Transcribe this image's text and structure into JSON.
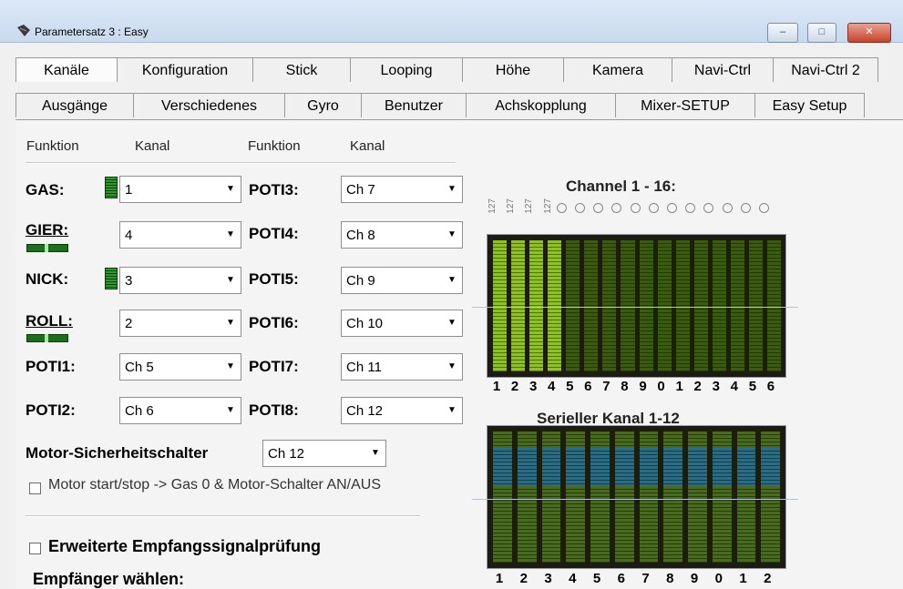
{
  "window": {
    "title": "Parametersatz 3 : Easy",
    "controls": [
      "–",
      "□",
      "✕"
    ]
  },
  "tabs_row1": [
    "Kanäle",
    "Konfiguration",
    "Stick",
    "Looping",
    "Höhe",
    "Kamera",
    "Navi-Ctrl",
    "Navi-Ctrl 2"
  ],
  "tabs_row2": [
    "Ausgänge",
    "Verschiedenes",
    "Gyro",
    "Benutzer",
    "Achskopplung",
    "Mixer-SETUP",
    "Easy Setup"
  ],
  "headers": {
    "funktion1": "Funktion",
    "kanal1": "Kanal",
    "funktion2": "Funktion",
    "kanal2": "Kanal"
  },
  "left_channels": [
    {
      "label": "GAS:",
      "value": "1"
    },
    {
      "label": "GIER:",
      "value": "4"
    },
    {
      "label": "NICK:",
      "value": "3"
    },
    {
      "label": "ROLL:",
      "value": "2"
    },
    {
      "label": "POTI1:",
      "value": "Ch 5"
    },
    {
      "label": "POTI2:",
      "value": "Ch 6"
    }
  ],
  "right_channels": [
    {
      "label": "POTI3:",
      "value": "Ch 7"
    },
    {
      "label": "POTI4:",
      "value": "Ch 8"
    },
    {
      "label": "POTI5:",
      "value": "Ch 9"
    },
    {
      "label": "POTI6:",
      "value": "Ch 10"
    },
    {
      "label": "POTI7:",
      "value": "Ch 11"
    },
    {
      "label": "POTI8:",
      "value": "Ch 12"
    }
  ],
  "motor_switch": {
    "label": "Motor-Sicherheitschalter",
    "value": "Ch 12"
  },
  "motor_start_stop": {
    "label": "Motor start/stop -> Gas 0 & Motor-Schalter AN/AUS",
    "checked": false
  },
  "extended_check": {
    "label": "Erweiterte Empfangssignalprüfung",
    "checked": false
  },
  "receiver_label": "Empfänger wählen:",
  "channel_display": {
    "title": "Channel 1 - 16:",
    "top_values": [
      "127",
      "127",
      "127",
      "127"
    ],
    "numbers": [
      "1",
      "2",
      "3",
      "4",
      "5",
      "6",
      "7",
      "8",
      "9",
      "0",
      "1",
      "2",
      "3",
      "4",
      "5",
      "6"
    ],
    "lit_channels": 4
  },
  "serial_display": {
    "title": "Serieller Kanal 1-12",
    "numbers": [
      "1",
      "2",
      "3",
      "4",
      "5",
      "6",
      "7",
      "8",
      "9",
      "0",
      "1",
      "2"
    ]
  }
}
